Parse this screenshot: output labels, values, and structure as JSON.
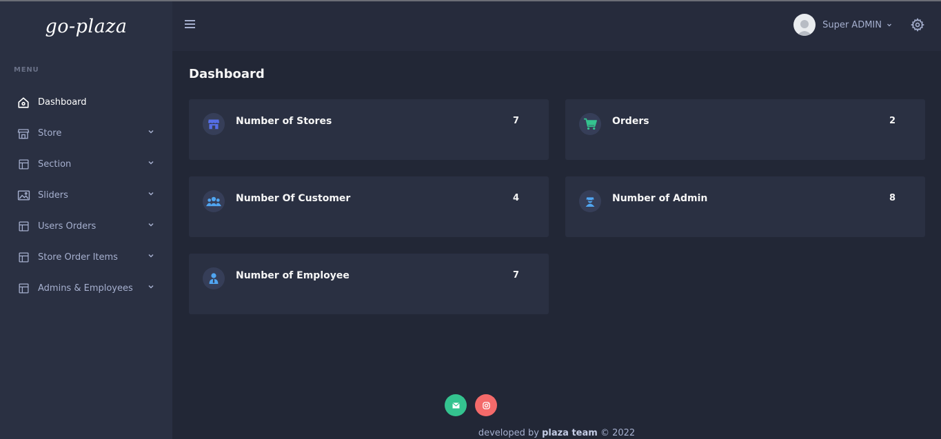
{
  "brand": {
    "name": "go-plaza"
  },
  "sidebar": {
    "menu_title": "MENU",
    "items": [
      {
        "label": "Dashboard",
        "icon": "home-icon",
        "active": true
      },
      {
        "label": "Store",
        "icon": "store-icon"
      },
      {
        "label": "Section",
        "icon": "layout-icon"
      },
      {
        "label": "Sliders",
        "icon": "image-icon"
      },
      {
        "label": "Users Orders",
        "icon": "layout-icon"
      },
      {
        "label": "Store Order Items",
        "icon": "layout-icon"
      },
      {
        "label": "Admins & Employees",
        "icon": "layout-icon"
      }
    ]
  },
  "header": {
    "user_name": "Super ADMIN",
    "menu_icon": "hamburger-icon",
    "settings_icon": "gear-icon"
  },
  "main": {
    "title": "Dashboard",
    "cards": [
      {
        "label": "Number of Stores",
        "value": "7",
        "icon": "storefront-icon",
        "icon_color": "#556ee6"
      },
      {
        "label": "Orders",
        "value": "2",
        "icon": "cart-icon",
        "icon_color": "#34c38f"
      },
      {
        "label": "Number Of Customer",
        "value": "4",
        "icon": "users-icon",
        "icon_color": "#50a5f1"
      },
      {
        "label": "Number of Admin",
        "value": "8",
        "icon": "admin-icon",
        "icon_color": "#50a5f1"
      },
      {
        "label": "Number of Employee",
        "value": "7",
        "icon": "employee-icon",
        "icon_color": "#50a5f1"
      }
    ]
  },
  "footer": {
    "prefix": "developed by",
    "team": "plaza team",
    "suffix": "© 2022",
    "social": [
      {
        "icon": "mail-icon",
        "color": "#34c38f"
      },
      {
        "icon": "instagram-icon",
        "color": "#f46a6a"
      }
    ]
  }
}
